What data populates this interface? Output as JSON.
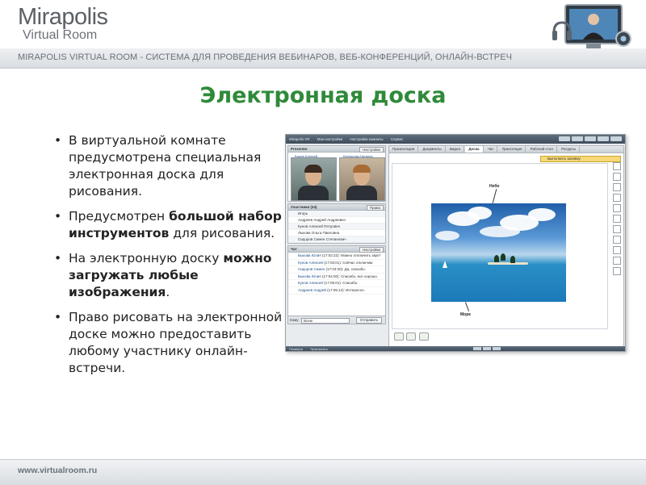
{
  "header": {
    "logo_title": "Mirapolis",
    "logo_sub": "Virtual Room",
    "tagline": "MIRAPOLIS VIRTUAL ROOM - СИСТЕМА ДЛЯ ПРОВЕДЕНИЯ ВЕБИНАРОВ, ВЕБ-КОНФЕРЕНЦИЙ, ОНЛАЙН-ВСТРЕЧ",
    "icon": "webcam-monitor-icon"
  },
  "slide": {
    "title": "Электронная доска",
    "bullets": [
      {
        "text": "В виртуальной комнате предусмотрена специальная электронная доска для рисования."
      },
      {
        "before": "Предусмотрен ",
        "bold": "большой набор инструментов",
        "after": " для рисования."
      },
      {
        "before": "На электронную доску ",
        "bold": "можно загружать любые изображения",
        "after": "."
      },
      {
        "text": "Право рисовать на электронной доске можно предоставить любому участнику онлайн-встречи."
      }
    ]
  },
  "app": {
    "menu": [
      "Mirapolis VR",
      "Мои настройки",
      "Настройки комнаты",
      "Сервис"
    ],
    "speakers_title": "Presenter",
    "speakers_button": "Настройки",
    "speaker_names": [
      "Быков Алексей",
      "Белоусова Наталья"
    ],
    "participants_title": "Участники (24)",
    "participants_button": "Права",
    "participants": [
      "Игорь",
      "Андреев Андрей Андреевич",
      "Кунов Алексей Петрович",
      "Лыкова Ольга Павловна",
      "Сидоров Семен Степанович"
    ],
    "chat_title": "Чат",
    "chat_button": "Настройки",
    "chat": [
      {
        "name": "Быкова Юлия",
        "text": "(17:02:22): Можно отключить звук?"
      },
      {
        "name": "Кунов Алексей",
        "text": "(17:03:01): Сейчас отключим."
      },
      {
        "name": "Сидоров Семен",
        "text": "(17:03:30): Да, спасибо."
      },
      {
        "name": "Быкова Юлия",
        "text": "(17:04:00): Спасибо, все хорошо."
      },
      {
        "name": "Кунов Алексей",
        "text": "(17:05:01): Спасибо."
      },
      {
        "name": "Андреев Андрей",
        "text": "(17:05:12): Интересно."
      }
    ],
    "chat_to_label": "Кому",
    "chat_to_value": "Всем",
    "send_button": "Отправить",
    "tabs": [
      "Презентация",
      "Документы",
      "Видео",
      "Доска",
      "Чат",
      "Трансляция",
      "Рабочий стол",
      "Ресурсы"
    ],
    "active_tab": "Доска",
    "notice": "Выполнить заливку",
    "sky_label": "Небо",
    "sea_label": "Море",
    "footer_left": [
      "Покинуть",
      "Пригласить"
    ]
  },
  "footer": {
    "site": "www.virtualroom.ru"
  }
}
